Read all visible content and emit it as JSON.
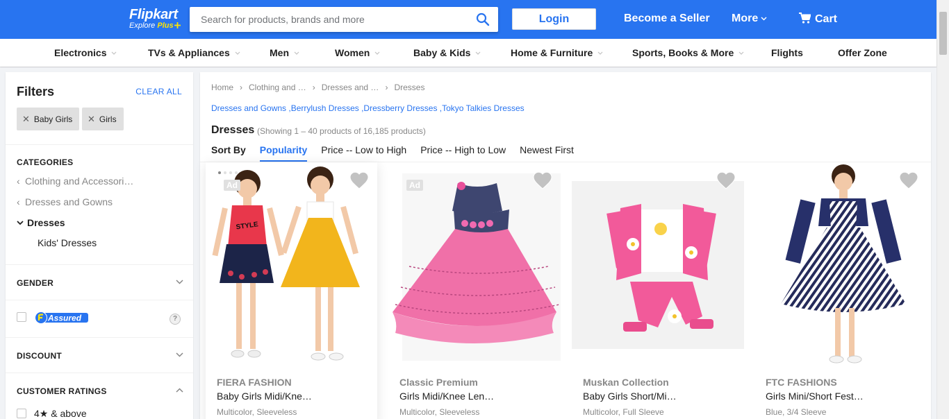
{
  "header": {
    "brand": "Flipkart",
    "tagline": "Explore",
    "tagline_plus": "Plus",
    "search_placeholder": "Search for products, brands and more",
    "login": "Login",
    "become_seller": "Become a Seller",
    "more": "More",
    "cart": "Cart"
  },
  "nav": [
    "Electronics",
    "TVs & Appliances",
    "Men",
    "Women",
    "Baby & Kids",
    "Home & Furniture",
    "Sports, Books & More",
    "Flights",
    "Offer Zone"
  ],
  "filters": {
    "title": "Filters",
    "clear_all": "CLEAR ALL",
    "chips": [
      "Baby Girls",
      "Girls"
    ],
    "categories_title": "CATEGORIES",
    "categories": [
      "Clothing and Accessori…",
      "Dresses and Gowns",
      "Dresses",
      "Kids' Dresses"
    ],
    "gender": "GENDER",
    "assured": "Assured",
    "assured_help": "?",
    "discount": "DISCOUNT",
    "ratings": "CUSTOMER RATINGS",
    "rating_option": "4★ & above"
  },
  "breadcrumb": [
    "Home",
    "Clothing and …",
    "Dresses and …",
    "Dresses"
  ],
  "related": [
    "Dresses and Gowns",
    "Berrylush Dresses",
    "Dressberry Dresses",
    "Tokyo Talkies Dresses"
  ],
  "page_title": "Dresses",
  "result_count": "(Showing 1 – 40 products of 16,185 products)",
  "sort": {
    "label": "Sort By",
    "options": [
      "Popularity",
      "Price -- Low to High",
      "Price -- High to Low",
      "Newest First"
    ],
    "active": "Popularity"
  },
  "products": [
    {
      "brand": "FIERA FASHION",
      "name": "Baby Girls Midi/Kne…",
      "meta": "Multicolor, Sleeveless",
      "ad": "Ad"
    },
    {
      "brand": "Classic Premium",
      "name": "Girls Midi/Knee Len…",
      "meta": "Multicolor, Sleeveless",
      "ad": "Ad"
    },
    {
      "brand": "Muskan Collection",
      "name": "Baby Girls Short/Mi…",
      "meta": "Multicolor, Full Sleeve"
    },
    {
      "brand": "FTC FASHIONS",
      "name": "Girls Mini/Short Fest…",
      "meta": "Blue, 3/4 Sleeve"
    }
  ],
  "colors": {
    "primary": "#2874f0",
    "accent": "#ffe500"
  }
}
